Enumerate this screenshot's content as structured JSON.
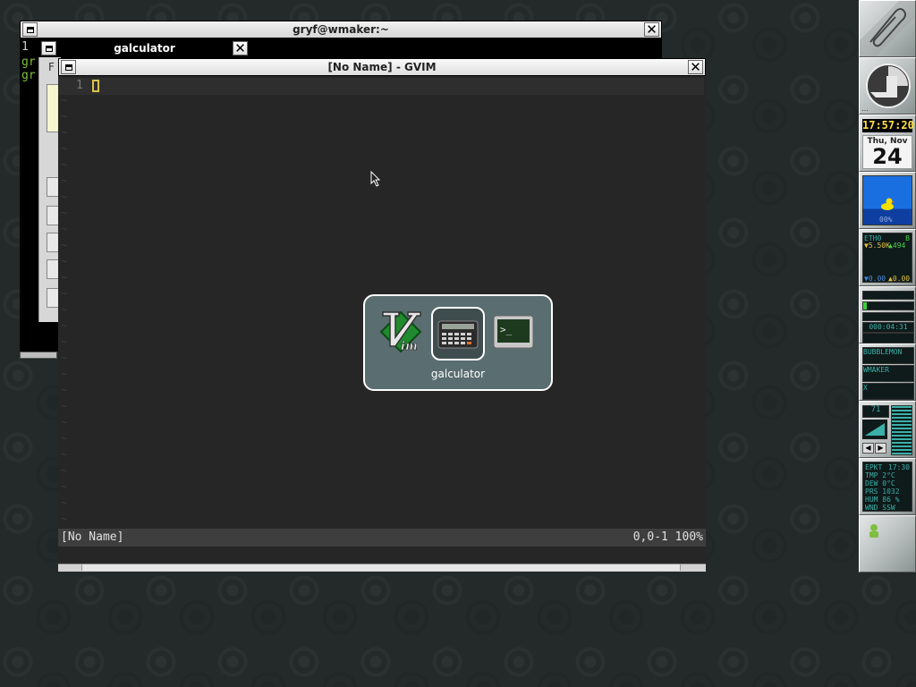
{
  "terminal": {
    "title": "gryf@wmaker:~",
    "line1": "gr",
    "line2": "gr",
    "tab_digit": "1"
  },
  "galculator": {
    "title": "galculator",
    "menu_letter": "F"
  },
  "gvim": {
    "title": "[No Name] - GVIM",
    "line_number": "1",
    "tilde": "~",
    "status_left": "[No Name]",
    "status_right": "0,0-1 100%"
  },
  "switcher": {
    "selected_label": "galculator",
    "items": [
      "vim-icon",
      "calculator-icon",
      "terminal-icon"
    ]
  },
  "dock": {
    "clock_time": "17:57:20",
    "date_day": "Thu, Nov",
    "date_num": "24",
    "duck_percent": "00%",
    "net_iface": "ETH0",
    "net_flag": "B",
    "net_rx": "▼5.50K",
    "net_tx": "▲494",
    "net_rx_total": "▼0.00",
    "net_tx_total": "▲0.00",
    "uptime": "000:04:31",
    "mail_bubblemon": "BUBBLEMON",
    "mail_wmaker": "WMAKER",
    "mail_x": "X",
    "mixer_value": "71",
    "weather_station": "EPKT",
    "weather_time": "17:30",
    "weather_tmp": "TMP      2°C",
    "weather_dew": "DEW      0°C",
    "weather_prs": "PRS  1032",
    "weather_hum": "HUM    86 %",
    "weather_wnd": "WND    SSW"
  },
  "colors": {
    "desktop": "#242a2a",
    "vim_background": "#262626",
    "clock_yellow": "#ffe14a",
    "switcher_bg": "#5f7376"
  }
}
